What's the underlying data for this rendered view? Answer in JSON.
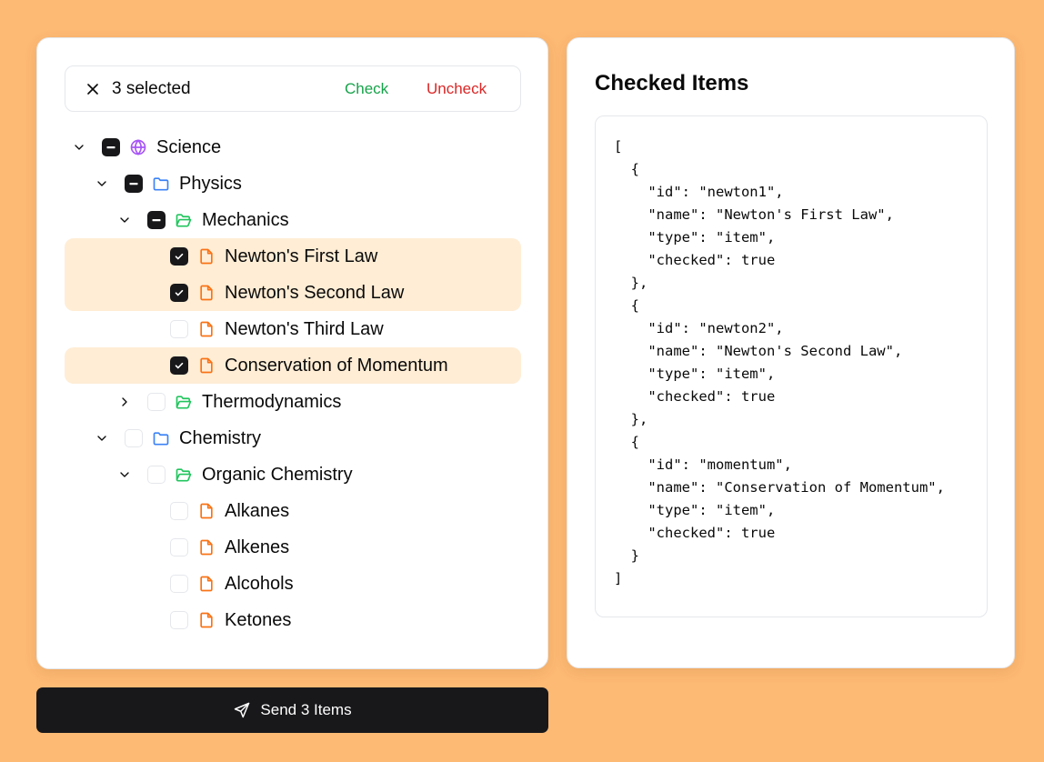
{
  "selection": {
    "count_label": "3 selected",
    "check_label": "Check",
    "uncheck_label": "Uncheck"
  },
  "tree": [
    {
      "label": "Science",
      "level": 0,
      "expander": "open",
      "state": "indeterminate",
      "icon": "globe-icon",
      "highlighted": false
    },
    {
      "label": "Physics",
      "level": 1,
      "expander": "open",
      "state": "indeterminate",
      "icon": "folder-icon",
      "highlighted": false
    },
    {
      "label": "Mechanics",
      "level": 2,
      "expander": "open",
      "state": "indeterminate",
      "icon": "folder-open-icon",
      "highlighted": false
    },
    {
      "label": "Newton's First Law",
      "level": 3,
      "expander": "none",
      "state": "checked",
      "icon": "file-icon",
      "highlighted": true
    },
    {
      "label": "Newton's Second Law",
      "level": 3,
      "expander": "none",
      "state": "checked",
      "icon": "file-icon",
      "highlighted": true
    },
    {
      "label": "Newton's Third Law",
      "level": 3,
      "expander": "none",
      "state": "unchecked",
      "icon": "file-icon",
      "highlighted": false
    },
    {
      "label": "Conservation of Momentum",
      "level": 3,
      "expander": "none",
      "state": "checked",
      "icon": "file-icon",
      "highlighted": true
    },
    {
      "label": "Thermodynamics",
      "level": 2,
      "expander": "closed",
      "state": "unchecked",
      "icon": "folder-open-icon",
      "highlighted": false
    },
    {
      "label": "Chemistry",
      "level": 1,
      "expander": "open",
      "state": "unchecked",
      "icon": "folder-icon",
      "highlighted": false
    },
    {
      "label": "Organic Chemistry",
      "level": 2,
      "expander": "open",
      "state": "unchecked",
      "icon": "folder-open-icon",
      "highlighted": false
    },
    {
      "label": "Alkanes",
      "level": 3,
      "expander": "none",
      "state": "unchecked",
      "icon": "file-icon",
      "highlighted": false
    },
    {
      "label": "Alkenes",
      "level": 3,
      "expander": "none",
      "state": "unchecked",
      "icon": "file-icon",
      "highlighted": false
    },
    {
      "label": "Alcohols",
      "level": 3,
      "expander": "none",
      "state": "unchecked",
      "icon": "file-icon",
      "highlighted": false
    },
    {
      "label": "Ketones",
      "level": 3,
      "expander": "none",
      "state": "unchecked",
      "icon": "file-icon",
      "highlighted": false
    }
  ],
  "send_button": {
    "label": "Send 3 Items"
  },
  "checked_panel": {
    "title": "Checked Items",
    "json_text": "[\n  {\n    \"id\": \"newton1\",\n    \"name\": \"Newton's First Law\",\n    \"type\": \"item\",\n    \"checked\": true\n  },\n  {\n    \"id\": \"newton2\",\n    \"name\": \"Newton's Second Law\",\n    \"type\": \"item\",\n    \"checked\": true\n  },\n  {\n    \"id\": \"momentum\",\n    \"name\": \"Conservation of Momentum\",\n    \"type\": \"item\",\n    \"checked\": true\n  }\n]"
  },
  "colors": {
    "background": "#fdba74",
    "highlight": "#ffedd5",
    "check": "#16a34a",
    "uncheck": "#dc2626",
    "globe": "#a855f7",
    "folder": "#3b82f6",
    "folder_open": "#22c55e",
    "file": "#f97316",
    "dark": "#18181b"
  }
}
